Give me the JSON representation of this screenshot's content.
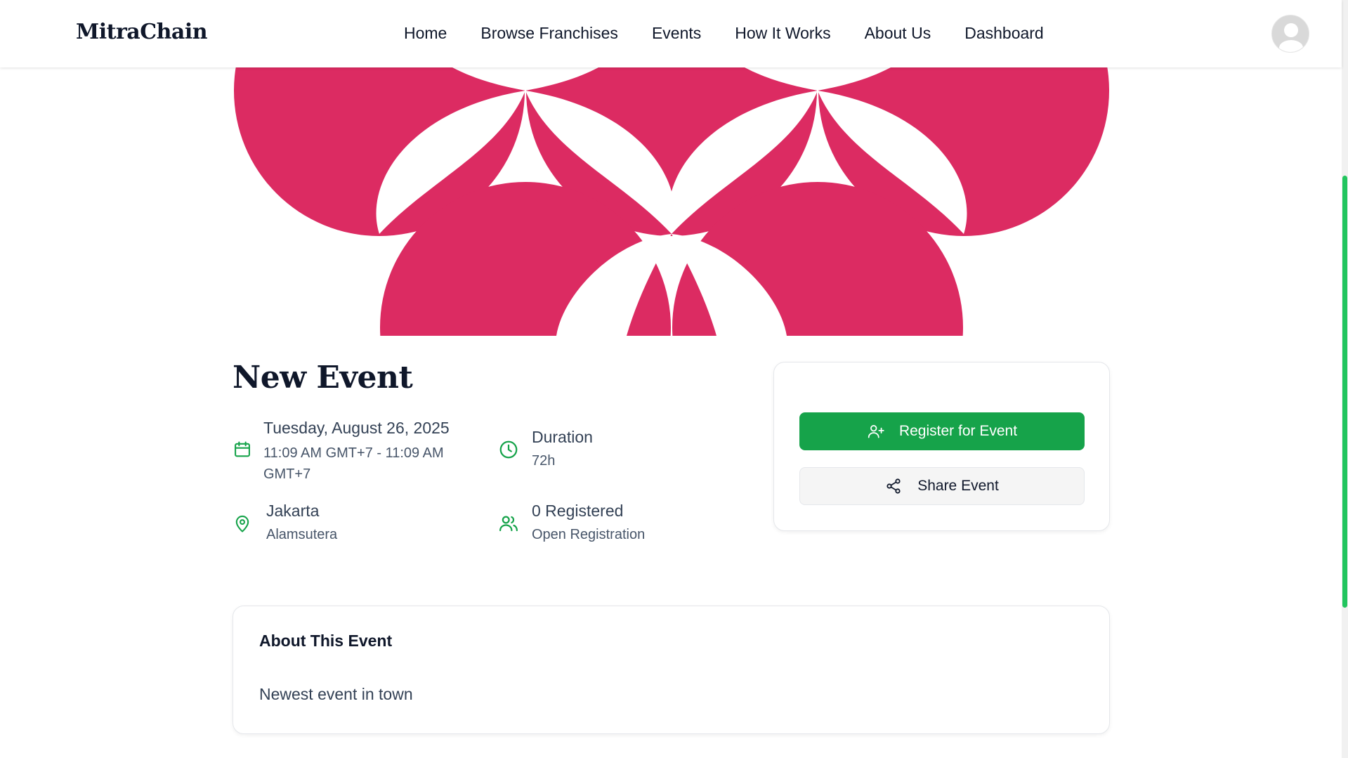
{
  "app": {
    "brand": "MitraChain"
  },
  "nav": {
    "items": [
      {
        "label": "Home"
      },
      {
        "label": "Browse Franchises"
      },
      {
        "label": "Events"
      },
      {
        "label": "How It Works"
      },
      {
        "label": "About Us"
      },
      {
        "label": "Dashboard"
      }
    ]
  },
  "colors": {
    "accent": "#16a34a",
    "banner_pattern": "#dc2b62",
    "scroll_thumb": "#22c55e"
  },
  "event": {
    "title": "New Event",
    "date": {
      "icon": "calendar-icon",
      "title": "Tuesday, August 26, 2025",
      "sub": "11:09 AM GMT+7 - 11:09 AM GMT+7"
    },
    "duration": {
      "icon": "clock-icon",
      "title": "Duration",
      "sub": "72h"
    },
    "location": {
      "icon": "map-pin-icon",
      "title": "Jakarta",
      "sub": "Alamsutera"
    },
    "registrations": {
      "icon": "users-icon",
      "title": "0 Registered",
      "sub": "Open Registration"
    }
  },
  "actions": {
    "register_label": "Register for Event",
    "register_icon": "user-plus-icon",
    "share_label": "Share Event",
    "share_icon": "share-icon"
  },
  "about": {
    "heading": "About This Event",
    "text": "Newest event in town"
  }
}
